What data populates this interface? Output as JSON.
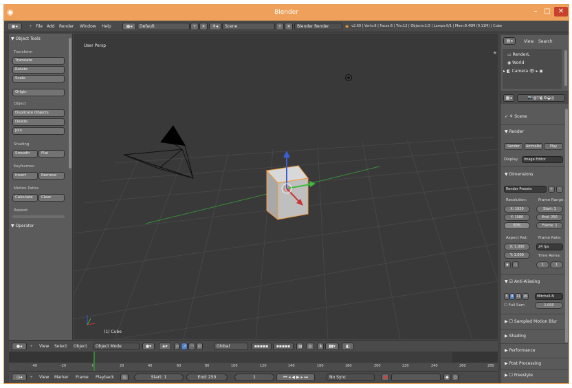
{
  "window": {
    "title": "Blender",
    "controls": {
      "minimize": "–",
      "maximize": "□",
      "close": "✕"
    }
  },
  "info_header": {
    "menus": [
      "File",
      "Add",
      "Render",
      "Window",
      "Help"
    ],
    "screen_layout": "Default",
    "scene": "Scene",
    "render_engine": "Blender Render",
    "stats": "v2.69 | Verts:8 | Faces:6 | Tris:12 | Objects:1/3 | Lamps:0/1 | Mem:8.49M (0.11M) | Cube"
  },
  "toolshelf": {
    "header": "▼ Object Tools",
    "sections": [
      {
        "label": "Transform",
        "buttons": [
          "Translate",
          "Rotate",
          "Scale"
        ]
      },
      {
        "label": "",
        "buttons": [
          "Origin"
        ]
      },
      {
        "label": "Object",
        "buttons": [
          "Duplicate Objects",
          "Delete",
          "Join"
        ]
      },
      {
        "label": "Shading",
        "buttons": [
          "Smooth",
          "Flat"
        ]
      },
      {
        "label": "Keyframes:",
        "buttons": [
          "Insert",
          "Remove"
        ]
      },
      {
        "label": "Motion Paths:",
        "buttons": [
          "Calculate",
          "Clear"
        ]
      },
      {
        "label": "Repeat:",
        "buttons": []
      }
    ],
    "operator_header": "▼ Operator"
  },
  "viewport": {
    "view_label": "User Persp",
    "object_label": "(1) Cube"
  },
  "view3d_header": {
    "menus": [
      "View",
      "Select",
      "Object"
    ],
    "mode": "Object Mode",
    "orientation": "Global"
  },
  "timeline": {
    "ticks": [
      "-40",
      "-20",
      "0",
      "20",
      "40",
      "60",
      "80",
      "100",
      "120",
      "140",
      "160",
      "180",
      "200",
      "220",
      "240",
      "260",
      "280"
    ],
    "current_frame_tick": "0"
  },
  "timeline_header": {
    "menus": [
      "View",
      "Marker",
      "Frame",
      "Playback"
    ],
    "start": "Start: 1",
    "end": "End: 250",
    "current": "1",
    "sync": "No Sync"
  },
  "outliner": {
    "menus": [
      "View",
      "Search"
    ],
    "items": [
      "RenderL",
      "World",
      "Camera"
    ]
  },
  "properties": {
    "scene_name": "Scene",
    "render_header": "▼ Render",
    "render_buttons": [
      "Render",
      "Animatio",
      "Play"
    ],
    "display_label": "Display",
    "display_value": "Image Editor",
    "dimensions_header": "▼ Dimensions",
    "render_presets": "Render Presets",
    "resolution_label": "Resolution:",
    "frame_range_label": "Frame Range:",
    "res_x": "X: 1920",
    "res_y": "Y: 1080",
    "res_pct": "50%",
    "start": "Start: 1",
    "end": "End: 250",
    "frame": "Frame: 1",
    "aspect_label": "Aspect Rat:",
    "frame_rate_label": "Frame Rate:",
    "aspect_x": "X: 1.000",
    "aspect_y": "Y: 1.000",
    "fps": "24 fps",
    "time_remap_label": "Time Rema:",
    "remap_old": "1",
    "remap_new": "1",
    "aa_header": "Anti-Aliasing",
    "aa_samples": [
      "5",
      "8",
      "11",
      "16"
    ],
    "aa_filter": "Mitchell-N",
    "full_sample": "Full Sam",
    "aa_size": "1.000",
    "panels": [
      "Sampled Motion Blur",
      "Shading",
      "Performance",
      "Post Processing",
      "Freestyle"
    ]
  },
  "colors": {
    "title_bar": "#efa15b",
    "close_button": "#c7412c",
    "viewport_bg": "#393939",
    "panel_bg": "#5a5a5a",
    "selected_object": "#f39c3e",
    "axis_x": "#cc3333",
    "axis_y": "#3fb93f",
    "axis_z": "#3a5fd6",
    "selection_blue": "#5680c2"
  }
}
